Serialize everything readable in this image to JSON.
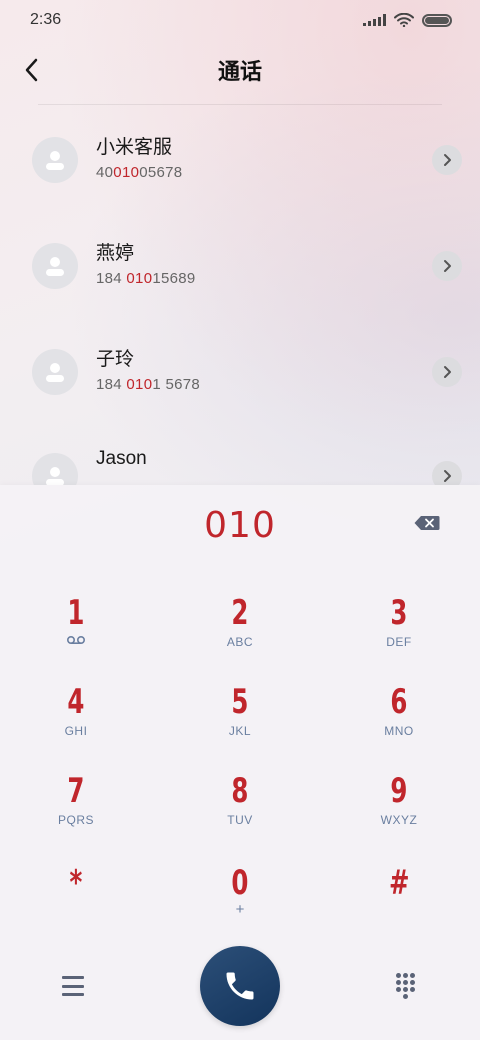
{
  "status_bar": {
    "time": "2:36",
    "battery_level": 1.0,
    "icons": [
      "signal-icon",
      "wifi-icon",
      "battery-icon"
    ]
  },
  "header": {
    "title": "通话",
    "back_icon": "chevron-left-icon"
  },
  "contacts": [
    {
      "name": "小米客服",
      "number_pre": "40",
      "number_match": "010",
      "number_post": "05678"
    },
    {
      "name": "燕婷",
      "number_pre": "184 ",
      "number_match": "010",
      "number_post": "15689"
    },
    {
      "name": "子玲",
      "number_pre": "184 ",
      "number_match": "010",
      "number_post": "1 5678"
    },
    {
      "name": "Jason",
      "number_pre": "",
      "number_match": "",
      "number_post": ""
    }
  ],
  "dialer": {
    "input": "010",
    "backspace_icon": "backspace-icon",
    "keys": [
      {
        "digit": "1",
        "letters": "",
        "sub": ""
      },
      {
        "digit": "2",
        "letters": "ABC",
        "sub": ""
      },
      {
        "digit": "3",
        "letters": "DEF",
        "sub": ""
      },
      {
        "digit": "4",
        "letters": "GHI",
        "sub": ""
      },
      {
        "digit": "5",
        "letters": "JKL",
        "sub": ""
      },
      {
        "digit": "6",
        "letters": "MNO",
        "sub": ""
      },
      {
        "digit": "7",
        "letters": "PQRS",
        "sub": ""
      },
      {
        "digit": "8",
        "letters": "TUV",
        "sub": ""
      },
      {
        "digit": "9",
        "letters": "WXYZ",
        "sub": ""
      },
      {
        "digit": "*",
        "letters": "",
        "sub": ""
      },
      {
        "digit": "0",
        "letters": "",
        "sub": "+"
      },
      {
        "digit": "#",
        "letters": "",
        "sub": ""
      }
    ]
  },
  "bottom_bar": {
    "menu_icon": "hamburger-menu-icon",
    "call_icon": "phone-icon",
    "keypad_icon": "dialpad-icon"
  },
  "colors": {
    "accent": "#c0262c",
    "letters": "#6a7fa0",
    "call_button": "#1e4068"
  }
}
